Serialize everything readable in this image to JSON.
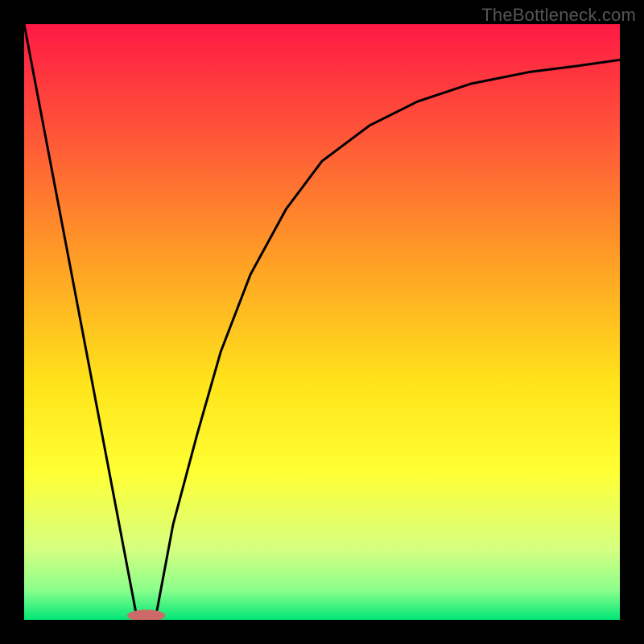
{
  "watermark": "TheBottleneck.com",
  "chart_data": {
    "type": "line",
    "title": "",
    "xlabel": "",
    "ylabel": "",
    "xlim": [
      0,
      1
    ],
    "ylim": [
      0,
      1
    ],
    "legend": false,
    "grid": false,
    "background_gradient": {
      "stops": [
        {
          "offset": 0.0,
          "color": "#ff1a45"
        },
        {
          "offset": 0.2,
          "color": "#ff5a37"
        },
        {
          "offset": 0.4,
          "color": "#ffa025"
        },
        {
          "offset": 0.6,
          "color": "#ffe31a"
        },
        {
          "offset": 0.75,
          "color": "#ffff33"
        },
        {
          "offset": 0.88,
          "color": "#d6ff80"
        },
        {
          "offset": 0.95,
          "color": "#8cff8c"
        },
        {
          "offset": 1.0,
          "color": "#00e676"
        }
      ]
    },
    "series": [
      {
        "name": "left-line",
        "x": [
          0.0,
          0.19
        ],
        "y": [
          1.0,
          0.0
        ],
        "stroke": "#000000",
        "width": 3
      },
      {
        "name": "right-curve",
        "x": [
          0.22,
          0.25,
          0.29,
          0.33,
          0.38,
          0.44,
          0.5,
          0.58,
          0.66,
          0.75,
          0.85,
          0.93,
          1.0
        ],
        "y": [
          0.0,
          0.16,
          0.31,
          0.45,
          0.58,
          0.69,
          0.77,
          0.83,
          0.87,
          0.9,
          0.92,
          0.93,
          0.94
        ],
        "stroke": "#000000",
        "width": 3
      }
    ],
    "marker": {
      "name": "bottom-capsule",
      "cx": 0.205,
      "cy": 0.007,
      "rx": 0.032,
      "ry": 0.01,
      "fill": "#cc6a6a"
    }
  }
}
